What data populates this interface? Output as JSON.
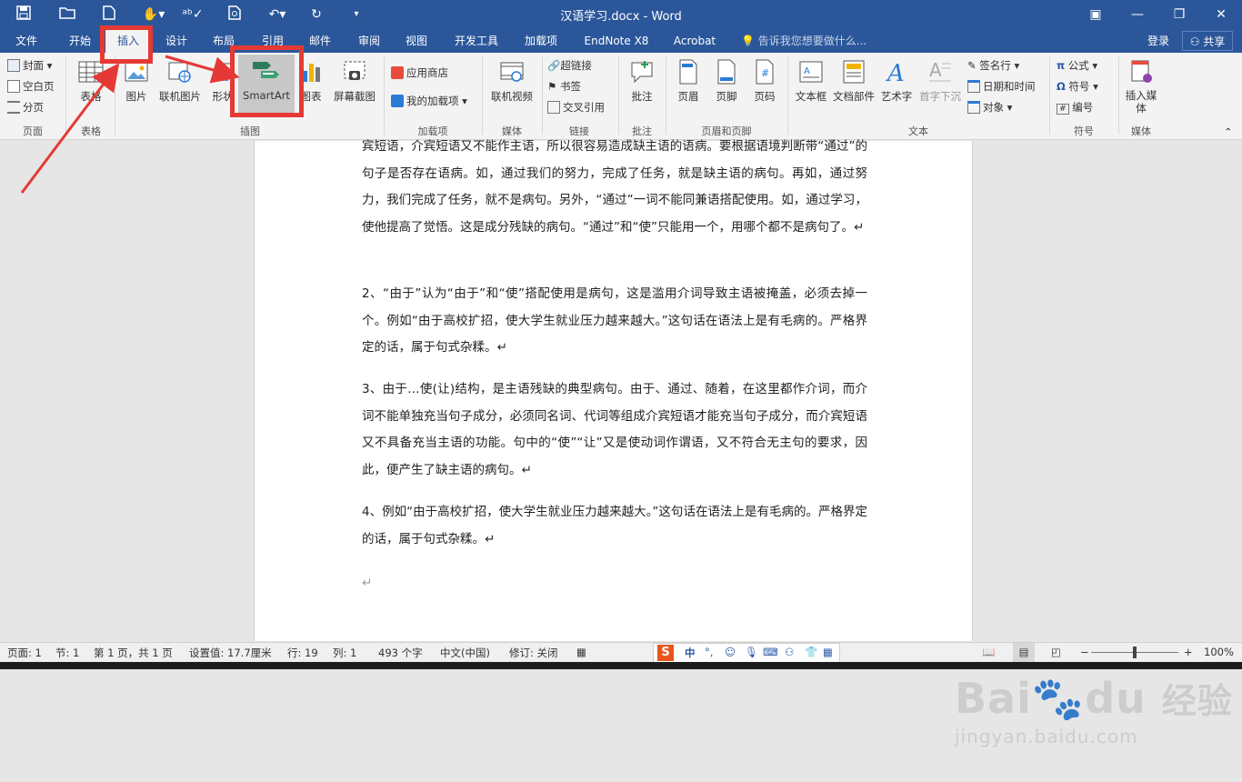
{
  "titlebar": {
    "title": "汉语学习.docx - Word",
    "quick_access": [
      "save-icon",
      "open-icon",
      "new-icon",
      "touch-mode-icon",
      "spelling-icon",
      "print-preview-icon",
      "undo-icon",
      "redo-icon",
      "customize-icon"
    ]
  },
  "tabs": {
    "file": "文件",
    "home": "开始",
    "insert": "插入",
    "design": "设计",
    "layout": "布局",
    "references": "引用",
    "mailings": "邮件",
    "review": "审阅",
    "view": "视图",
    "developer": "开发工具",
    "addins": "加载项",
    "endnote": "EndNote X8",
    "acrobat": "Acrobat",
    "tellme": "告诉我您想要做什么...",
    "login": "登录",
    "share": "共享"
  },
  "ribbon": {
    "pages": {
      "cover": "封面",
      "blank": "空白页",
      "break": "分页",
      "group": "页面"
    },
    "tables": {
      "table": "表格",
      "group": "表格"
    },
    "illustrations": {
      "picture": "图片",
      "online_picture": "联机图片",
      "shapes": "形状",
      "smartart": "SmartArt",
      "chart": "图表",
      "screenshot": "屏幕截图",
      "group": "插图"
    },
    "addins": {
      "store": "应用商店",
      "my_addins": "我的加载项",
      "group": "加载项"
    },
    "media": {
      "online_video": "联机视频",
      "group": "媒体"
    },
    "links": {
      "hyperlink": "超链接",
      "bookmark": "书签",
      "crossref": "交叉引用",
      "group": "链接"
    },
    "comments": {
      "comment": "批注",
      "group": "批注"
    },
    "header_footer": {
      "header": "页眉",
      "footer": "页脚",
      "page_number": "页码",
      "group": "页眉和页脚"
    },
    "text": {
      "textbox": "文本框",
      "quickparts": "文档部件",
      "wordart": "艺术字",
      "dropcap": "首字下沉",
      "signature": "签名行",
      "datetime": "日期和时间",
      "object": "对象",
      "group": "文本"
    },
    "symbols": {
      "equation": "公式",
      "symbol": "符号",
      "number": "编号",
      "group": "符号"
    },
    "media2": {
      "insert_media": "插入媒体",
      "group": "媒体"
    }
  },
  "document": {
    "paragraphs": [
      "宾短语，介宾短语又不能作主语，所以很容易造成缺主语的语病。要根据语境判断带“通过”的句子是否存在语病。如，通过我们的努力，完成了任务，就是缺主语的病句。再如，通过努力，我们完成了任务，就不是病句。另外，“通过”一词不能同兼语搭配使用。如，通过学习，使他提高了觉悟。这是成分残缺的病句。“通过”和“使”只能用一个，用哪个都不是病句了。↵",
      "2、“由于”认为“由于”和“使”搭配使用是病句，这是滥用介词导致主语被掩盖，必须去掉一个。例如“由于高校扩招，使大学生就业压力越来越大。”这句话在语法上是有毛病的。严格界定的话，属于句式杂糅。↵",
      "3、由于…使(让)结构，是主语残缺的典型病句。由于、通过、随着，在这里都作介词，而介词不能单独充当句子成分，必须同名词、代词等组成介宾短语才能充当句子成分，而介宾短语又不具备充当主语的功能。句中的“使”“让”又是使动词作谓语，又不符合无主句的要求，因此，便产生了缺主语的病句。↵",
      "4、例如“由于高校扩招，使大学生就业压力越来越大。”这句话在语法上是有毛病的。严格界定的话，属于句式杂糅。↵",
      "↵"
    ]
  },
  "statusbar": {
    "page": "页面: 1",
    "section": "节: 1",
    "pages": "第 1 页，共 1 页",
    "setting": "设置值: 17.7厘米",
    "row": "行: 19",
    "col": "列: 1",
    "chars": "493 个字",
    "lang": "中文(中国)",
    "track": "修订: 关闭",
    "zoom": "100%",
    "zoom_minus": "−",
    "zoom_plus": "+"
  },
  "ime": {
    "brand": "S",
    "mode": "中",
    "punct": "°,"
  },
  "watermark": {
    "logo": "Bai",
    "suffix": "du",
    "cn": "经验",
    "url": "jingyan.baidu.com"
  },
  "colors": {
    "accent": "#2b579a",
    "highlight": "#e53935"
  }
}
